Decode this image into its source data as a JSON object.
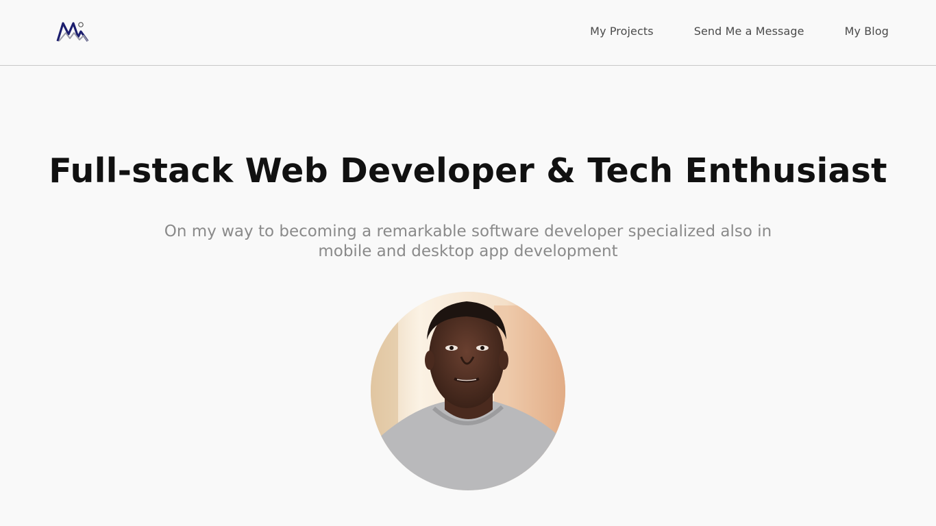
{
  "brand": {
    "logo_icon": "mountain-logo-icon",
    "logo_color": "#1c1e6e"
  },
  "nav": {
    "items": [
      {
        "label": "My Projects"
      },
      {
        "label": "Send Me a Message"
      },
      {
        "label": "My Blog"
      }
    ]
  },
  "hero": {
    "title": "Full-stack Web Developer & Tech Enthusiast",
    "subtitle_line1": "On my way to becoming a remarkable software developer specialized also in",
    "subtitle_line2": "mobile and desktop app development",
    "avatar_icon": "profile-photo"
  },
  "colors": {
    "background": "#f9f9f9",
    "title": "#111111",
    "subtitle": "#8a8a8a",
    "nav_text": "#4a4a4a"
  }
}
